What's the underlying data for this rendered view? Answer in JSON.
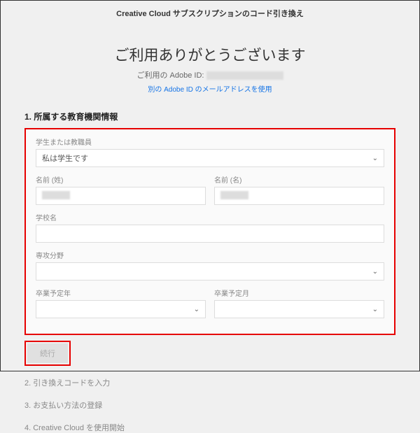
{
  "header": {
    "title": "Creative Cloud サブスクリプションのコード引き換え"
  },
  "thanks": "ご利用ありがとうございます",
  "id_label": "ご利用の Adobe ID: ",
  "other_id_link": "別の Adobe ID のメールアドレスを使用",
  "section1": {
    "heading": "1. 所属する教育機関情報",
    "role_label": "学生または教職員",
    "role_value": "私は学生です",
    "lastname_label": "名前 (姓)",
    "firstname_label": "名前 (名)",
    "school_label": "学校名",
    "major_label": "専攻分野",
    "grad_year_label": "卒業予定年",
    "grad_month_label": "卒業予定月",
    "continue_label": "続行"
  },
  "section2": "2. 引き換えコードを入力",
  "section3": "3. お支払い方法の登録",
  "section4": "4. Creative Cloud を使用開始"
}
